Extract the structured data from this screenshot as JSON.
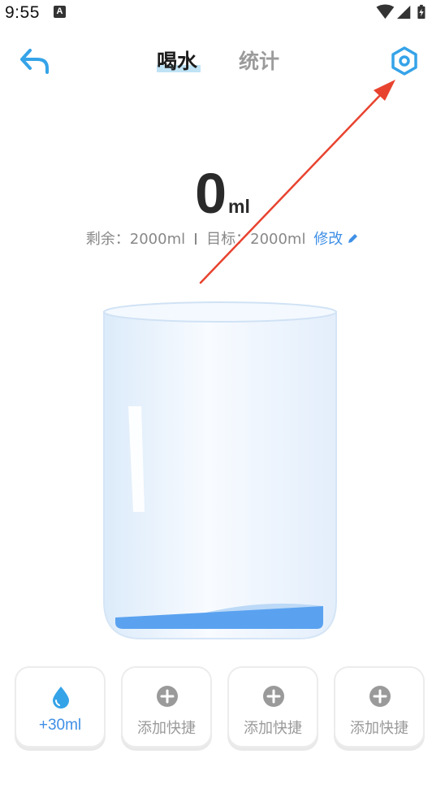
{
  "status_bar": {
    "time": "9:55",
    "notification_icon_letter": "A",
    "icons": [
      "wifi-icon",
      "signal-icon",
      "battery-charging-icon"
    ]
  },
  "header": {
    "back_icon": "back-arrow-icon",
    "tabs": [
      {
        "label": "喝水",
        "active": true
      },
      {
        "label": "统计",
        "active": false
      }
    ],
    "settings_icon": "settings-hexagon-icon"
  },
  "intake": {
    "value": "0",
    "unit": "ml"
  },
  "summary": {
    "remaining_text": "剩余：2000ml",
    "goal_text": "目标：2000ml",
    "edit_label": "修改",
    "edit_icon": "pencil-icon"
  },
  "glass": {
    "fill_fraction": 0
  },
  "quick_add": [
    {
      "label": "+30ml",
      "icon": "water-drop-icon",
      "active": true
    },
    {
      "label": "添加快捷",
      "icon": "add-circle-icon",
      "active": false
    },
    {
      "label": "添加快捷",
      "icon": "add-circle-icon",
      "active": false
    },
    {
      "label": "添加快捷",
      "icon": "add-circle-icon",
      "active": false
    }
  ],
  "colors": {
    "accent": "#3f8fe6",
    "icon_blue": "#35a3e8",
    "water": "#5aa2f0",
    "annotation_arrow": "#e8432f"
  }
}
